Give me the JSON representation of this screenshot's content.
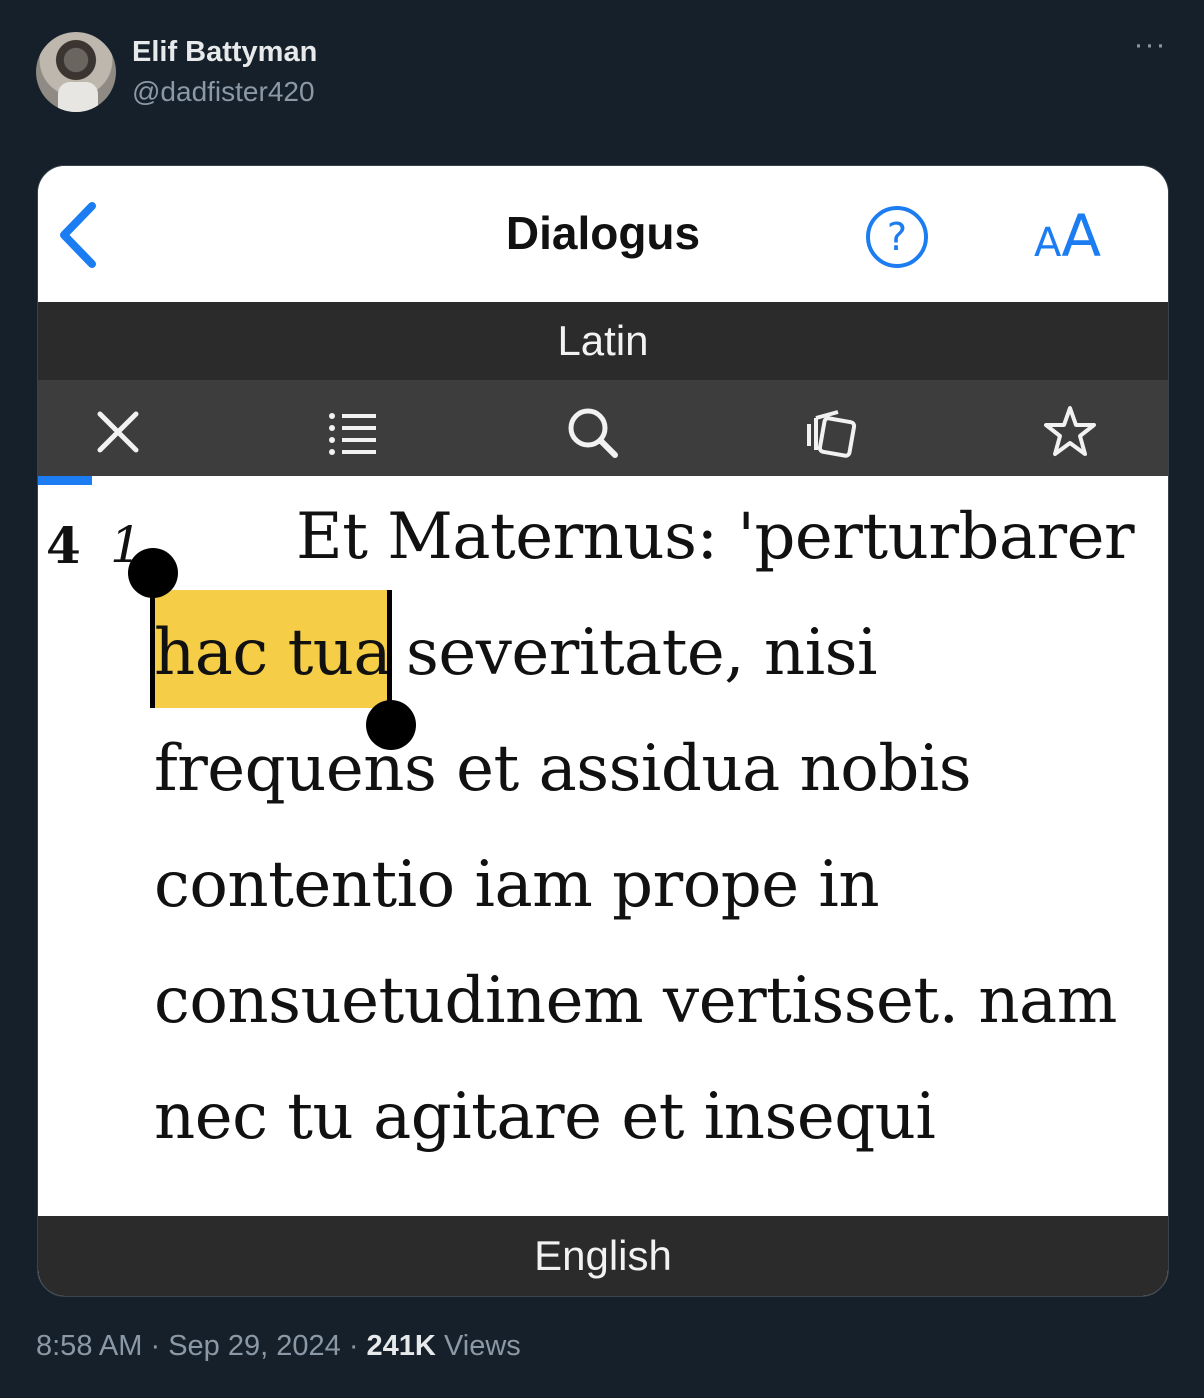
{
  "tweet": {
    "author_name": "Elif Battyman",
    "author_handle": "@dadfister420",
    "time": "8:58 AM",
    "date": "Sep 29, 2024",
    "views_count": "241K",
    "views_label": "Views",
    "separator": "·"
  },
  "app": {
    "title": "Dialogus",
    "font_size_small": "A",
    "font_size_big": "A",
    "top_language": "Latin",
    "bottom_language": "English",
    "accent_color": "#1c7cf1",
    "highlight_color": "#f6cd47"
  },
  "toolbar": {
    "icons": [
      "close-icon",
      "list-icon",
      "search-icon",
      "cards-icon",
      "star-icon"
    ]
  },
  "reader": {
    "section": "4",
    "verse": "1",
    "selected_text": "hac tua",
    "lines": [
      "Et Maternus: 'perturbarer",
      "severitate, nisi",
      "frequens et assidua nobis",
      "contentio iam prope in",
      "consuetudinem vertisset. nam",
      "nec tu agitare et insequi"
    ]
  }
}
